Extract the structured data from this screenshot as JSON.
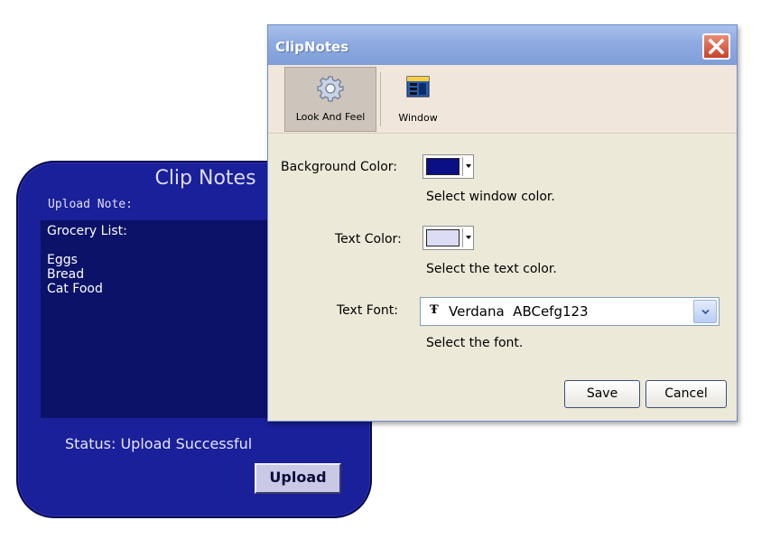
{
  "widget": {
    "title": "Clip Notes",
    "upload_label": "Upload Note:",
    "note_text": "Grocery List:\n\nEggs\nBread\nCat Food",
    "status": "Status: Upload Successful",
    "upload_button": "Upload",
    "colors": {
      "background": "#1a1f9a",
      "text_area": "#0b1268"
    }
  },
  "dialog": {
    "title": "ClipNotes",
    "close_icon": "close-x-icon",
    "tabs": [
      {
        "label": "Look And Feel",
        "icon": "gear-icon",
        "active": true
      },
      {
        "label": "Window",
        "icon": "window-icon",
        "active": false
      }
    ],
    "background_color": {
      "label": "Background Color:",
      "value": "#0a0f86",
      "helper": "Select window color."
    },
    "text_color": {
      "label": "Text Color:",
      "value": "#dcdcf4",
      "helper": "Select the text color."
    },
    "text_font": {
      "label": "Text Font:",
      "icon": "font-icon",
      "value": "Verdana  ABCefg123",
      "helper": "Select the font."
    },
    "buttons": {
      "save": "Save",
      "cancel": "Cancel"
    }
  }
}
